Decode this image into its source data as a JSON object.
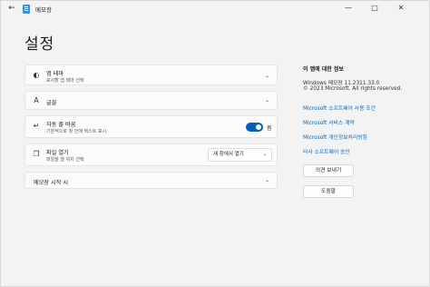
{
  "window": {
    "title": "메모장",
    "back_glyph": "←",
    "minimize_glyph": "—",
    "maximize_glyph": "□",
    "close_glyph": "✕"
  },
  "page": {
    "title": "설정"
  },
  "settings": {
    "theme": {
      "label": "앱 테마",
      "sub": "표시할 앱 테마 선택",
      "icon": "palette-icon"
    },
    "font": {
      "label": "글꼴",
      "icon": "font-icon"
    },
    "wrap": {
      "label": "자동 줄 바꿈",
      "sub": "기본적으로 창 안에 텍스트 표시",
      "toggle_state": "켬",
      "toggle_on": true,
      "icon": "word-wrap-icon"
    },
    "open_file": {
      "label": "파일 열기",
      "sub": "파일을 열 위치 선택",
      "selected": "새 창에서 열기",
      "icon": "open-file-icon"
    },
    "startup": {
      "label": "메모장 시작 시"
    }
  },
  "about": {
    "title": "이 앱에 대한 정보",
    "version": "Windows 메모장 11.2311.33.0",
    "copyright": "© 2023 Microsoft. All rights reserved.",
    "links": [
      "Microsoft 소프트웨어 사용 조건",
      "Microsoft 서비스 계약",
      "Microsoft 개인정보처리방침",
      "타사 소프트웨어 승인"
    ],
    "feedback_button": "의견 보내기",
    "help_button": "도움말"
  },
  "colors": {
    "accent": "#005fb8",
    "link": "#0067c0",
    "background": "#f3f3f3"
  }
}
